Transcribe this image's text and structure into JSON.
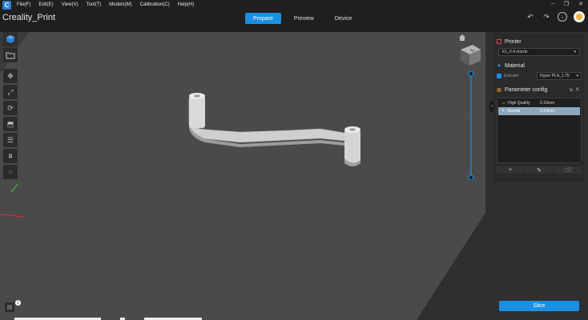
{
  "menu": {
    "items": [
      "File(F)",
      "Edit(E)",
      "View(V)",
      "Tool(T)",
      "Models(M)",
      "Calibration(C)",
      "Help(H)"
    ]
  },
  "window_controls": [
    "–",
    "❐",
    "✕"
  ],
  "app_title": "Creality_Print",
  "tabs": [
    {
      "label": "Prepare",
      "active": true
    },
    {
      "label": "Preview",
      "active": false
    },
    {
      "label": "Device",
      "active": false
    }
  ],
  "toolbar_icons": [
    "undo-icon",
    "redo-icon",
    "download-icon",
    "avatar"
  ],
  "left_toolbar_icons": [
    "add-model-icon",
    "open-folder-icon",
    "move-icon",
    "scale-icon",
    "rotate-icon",
    "lay-flat-icon",
    "split-icon",
    "support-icon",
    "arrange-icon"
  ],
  "printer": {
    "header": "Printer",
    "selected": "K1_0.4 nozzle"
  },
  "material": {
    "header": "Material",
    "extruder_label": "Extruder",
    "selected": "Hyper PLA_1.75"
  },
  "parameter_config": {
    "header": "Parameter config",
    "profiles": [
      {
        "name": "High Quality",
        "value": "0.10mm",
        "selected": false
      },
      {
        "name": "Normal",
        "value": "0.10mm",
        "selected": true
      }
    ],
    "actions": [
      "+",
      "✎",
      "⌫"
    ]
  },
  "slice_button": "Slice",
  "notification_count": "1",
  "colors": {
    "accent": "#1a8fe3",
    "bed": "#4b4b4b",
    "background": "#3a3a3a",
    "panel": "#2a2a2a"
  }
}
